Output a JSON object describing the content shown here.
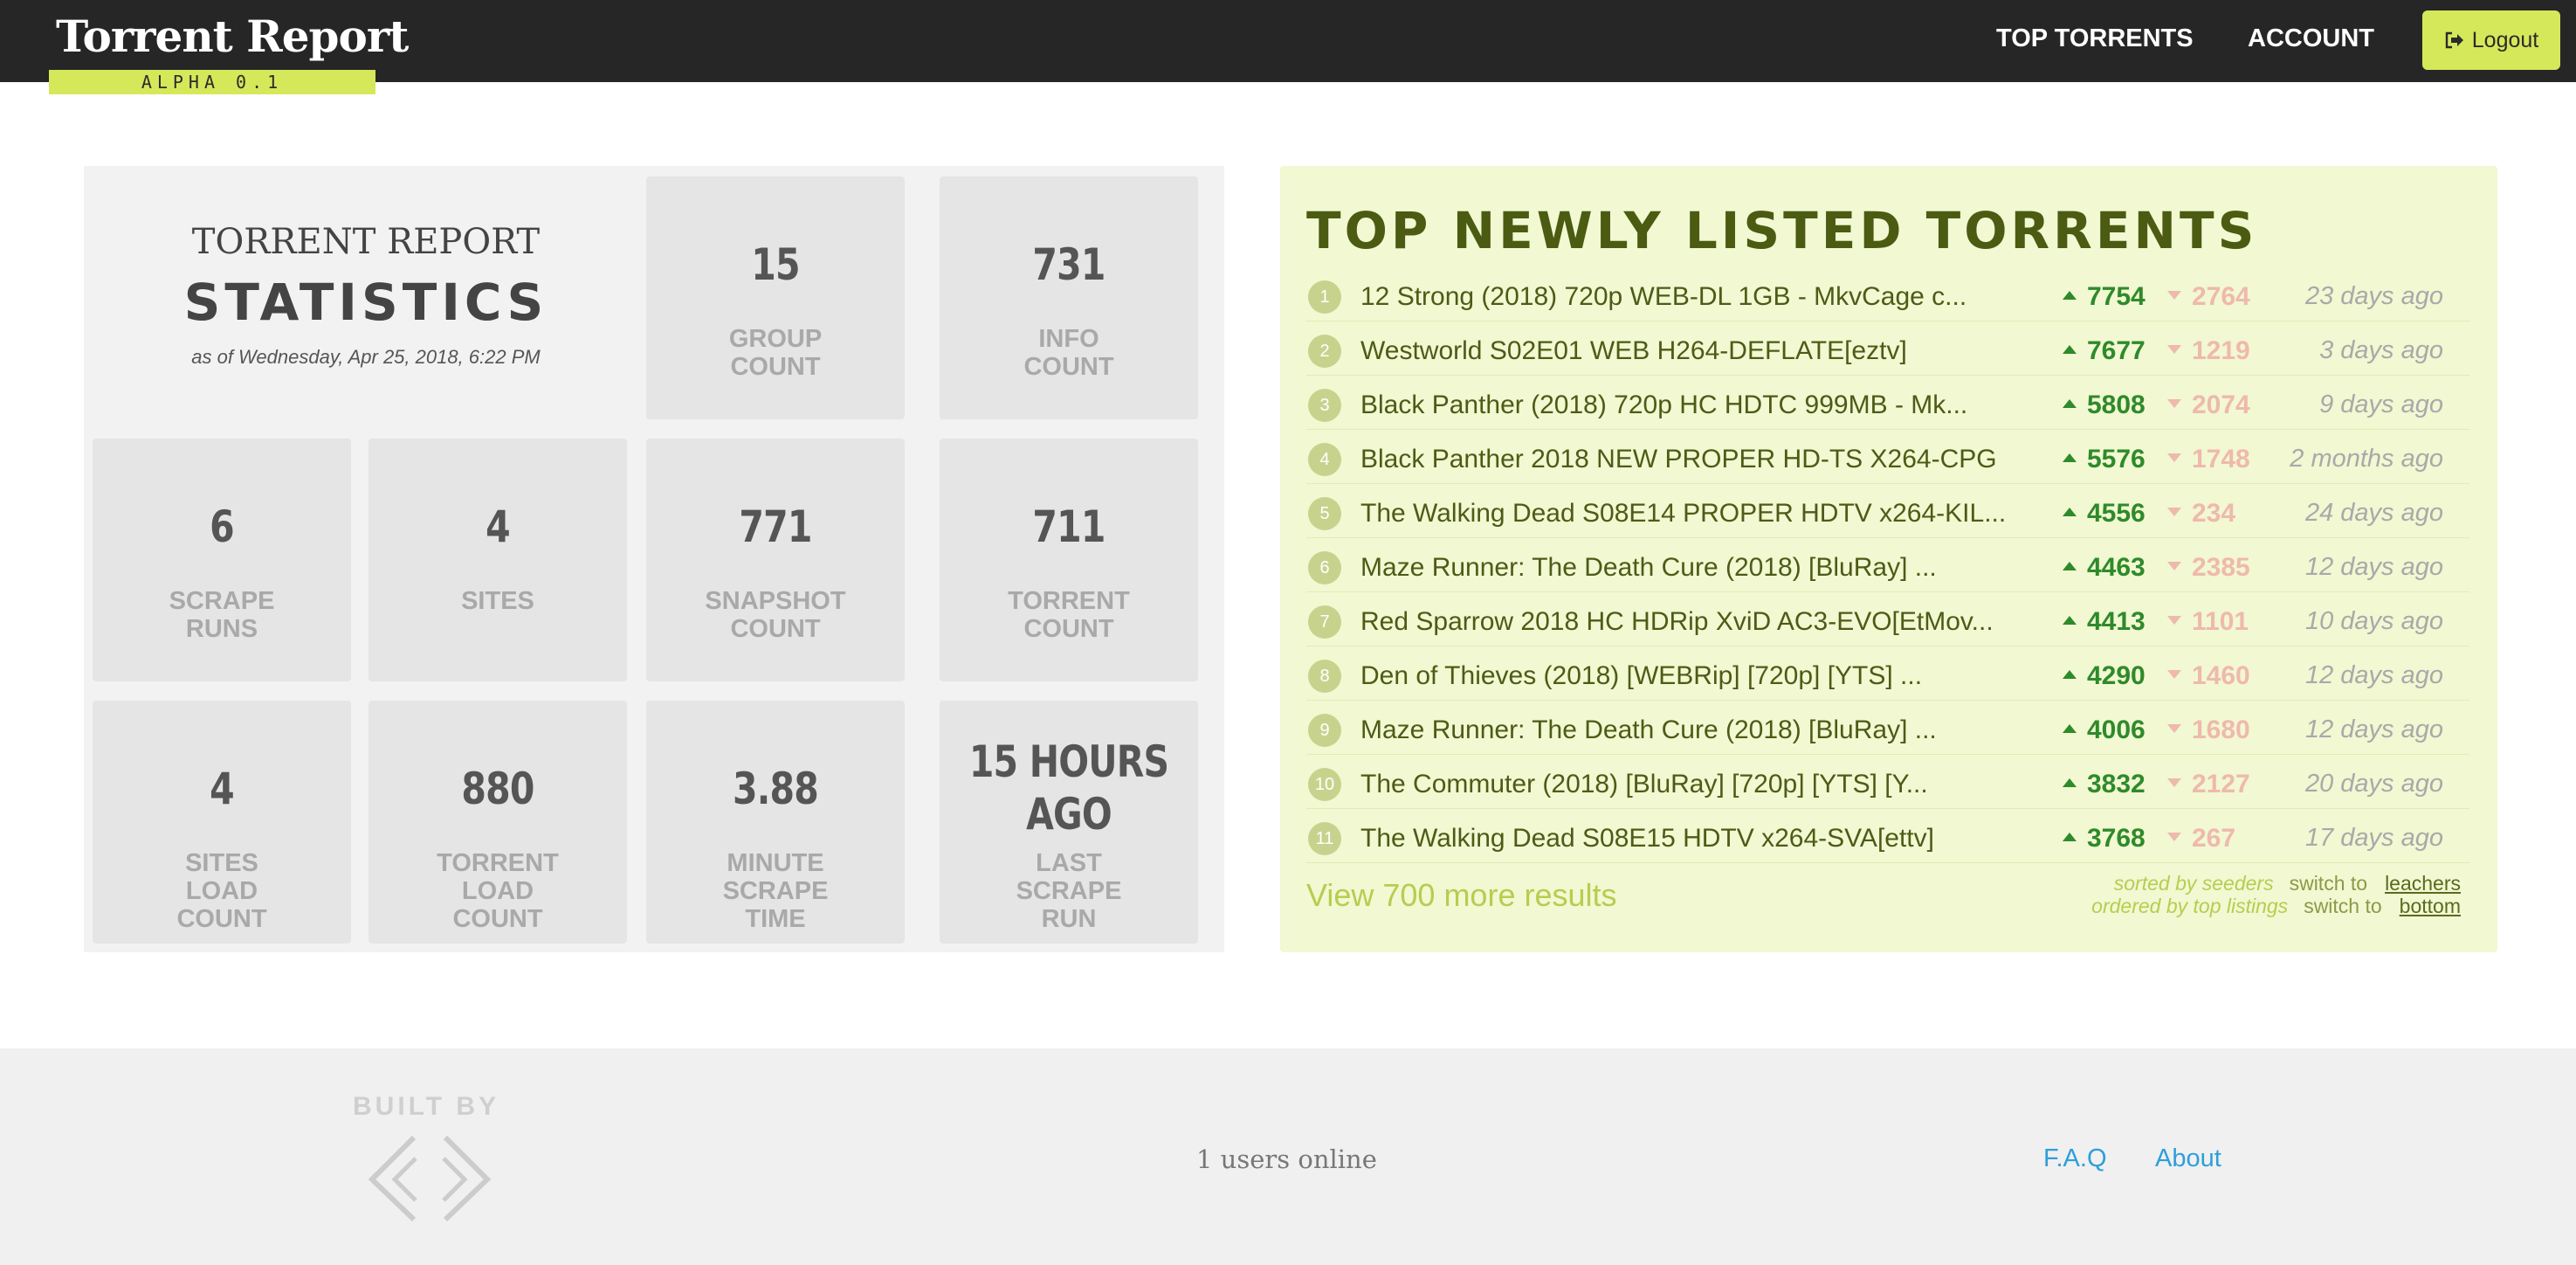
{
  "header": {
    "brand_title": "Torrent Report",
    "brand_tag": "ALPHA 0.1",
    "nav": [
      "TOP TORRENTS",
      "ACCOUNT"
    ],
    "logout_label": "Logout",
    "colors": {
      "bar": "#262626",
      "accent": "#d5e85a"
    }
  },
  "stats": {
    "title_line1": "TORRENT REPORT",
    "title_line2": "STATISTICS",
    "as_of": "as of Wednesday, Apr 25, 2018, 6:22 PM",
    "tiles": [
      {
        "value": "15",
        "label": "GROUP\nCOUNT"
      },
      {
        "value": "731",
        "label": "INFO\nCOUNT"
      },
      {
        "value": "6",
        "label": "SCRAPE\nRUNS"
      },
      {
        "value": "4",
        "label": "SITES"
      },
      {
        "value": "771",
        "label": "SNAPSHOT\nCOUNT"
      },
      {
        "value": "711",
        "label": "TORRENT\nCOUNT"
      },
      {
        "value": "4",
        "label": "SITES\nLOAD\nCOUNT"
      },
      {
        "value": "880",
        "label": "TORRENT\nLOAD\nCOUNT"
      },
      {
        "value": "3.88",
        "label": "MINUTE\nSCRAPE\nTIME"
      },
      {
        "value": "15 HOURS\nAGO",
        "label": "LAST\nSCRAPE\nRUN"
      }
    ]
  },
  "torrents": {
    "heading": "TOP NEWLY LISTED TORRENTS",
    "rows": [
      {
        "rank": "1",
        "name": "12 Strong (2018) 720p WEB-DL 1GB - MkvCage c...",
        "seeders": "7754",
        "leechers": "2764",
        "age": "23 days ago"
      },
      {
        "rank": "2",
        "name": "Westworld S02E01 WEB H264-DEFLATE[eztv]",
        "seeders": "7677",
        "leechers": "1219",
        "age": "3 days ago"
      },
      {
        "rank": "3",
        "name": "Black Panther (2018) 720p HC HDTC 999MB - Mk...",
        "seeders": "5808",
        "leechers": "2074",
        "age": "9 days ago"
      },
      {
        "rank": "4",
        "name": "Black Panther 2018 NEW PROPER HD-TS X264-CPG",
        "seeders": "5576",
        "leechers": "1748",
        "age": "2 months ago"
      },
      {
        "rank": "5",
        "name": "The Walking Dead S08E14 PROPER HDTV x264-KIL...",
        "seeders": "4556",
        "leechers": "234",
        "age": "24 days ago"
      },
      {
        "rank": "6",
        "name": "Maze Runner: The Death Cure (2018) [BluRay] ...",
        "seeders": "4463",
        "leechers": "2385",
        "age": "12 days ago"
      },
      {
        "rank": "7",
        "name": "Red Sparrow 2018 HC HDRip XviD AC3-EVO[EtMov...",
        "seeders": "4413",
        "leechers": "1101",
        "age": "10 days ago"
      },
      {
        "rank": "8",
        "name": "Den of Thieves (2018) [WEBRip] [720p] [YTS] ...",
        "seeders": "4290",
        "leechers": "1460",
        "age": "12 days ago"
      },
      {
        "rank": "9",
        "name": "Maze Runner: The Death Cure (2018) [BluRay] ...",
        "seeders": "4006",
        "leechers": "1680",
        "age": "12 days ago"
      },
      {
        "rank": "10",
        "name": "The Commuter (2018) [BluRay] [720p] [YTS] [Y...",
        "seeders": "3832",
        "leechers": "2127",
        "age": "20 days ago"
      },
      {
        "rank": "11",
        "name": "The Walking Dead S08E15 HDTV x264-SVA[ettv]",
        "seeders": "3768",
        "leechers": "267",
        "age": "17 days ago"
      }
    ],
    "more_results": "View 700 more results",
    "sorted_state": "sorted by seeders",
    "sorted_switch": "switch to",
    "sorted_toggle": "leachers",
    "ordered_state": "ordered by top listings",
    "ordered_switch": "switch to",
    "ordered_toggle": "bottom"
  },
  "footer": {
    "built_by": "BUILT BY",
    "users_online": "1 users online",
    "links": [
      "F.A.Q",
      "About"
    ]
  }
}
